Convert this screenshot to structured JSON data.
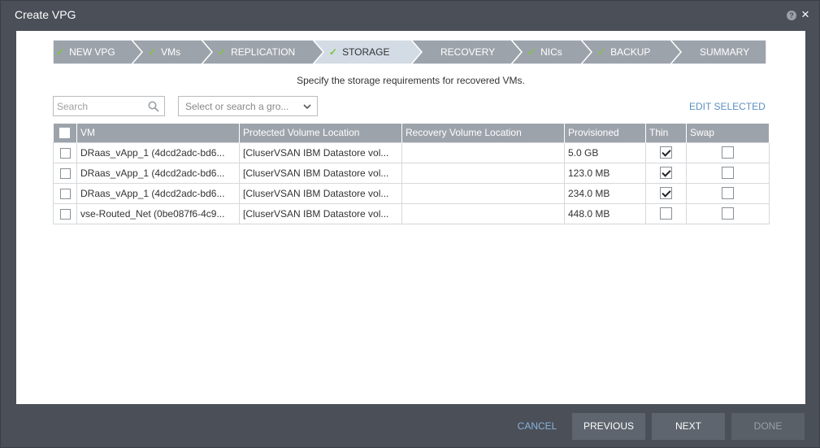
{
  "window": {
    "title": "Create VPG",
    "help_label": "?",
    "close_label": "×"
  },
  "steps": [
    {
      "label": "NEW VPG",
      "done": true
    },
    {
      "label": "VMs",
      "done": true
    },
    {
      "label": "REPLICATION",
      "done": true
    },
    {
      "label": "STORAGE",
      "done": true,
      "active": true
    },
    {
      "label": "RECOVERY",
      "done": false
    },
    {
      "label": "NICs",
      "done": true
    },
    {
      "label": "BACKUP",
      "done": true
    },
    {
      "label": "SUMMARY",
      "done": false
    }
  ],
  "check_glyph": "✓",
  "subtitle": "Specify the storage requirements for recovered VMs.",
  "search": {
    "placeholder": "Search"
  },
  "select": {
    "placeholder": "Select or search a gro..."
  },
  "edit_selected": "EDIT SELECTED",
  "table": {
    "columns": [
      "VM",
      "Protected Volume Location",
      "Recovery Volume Location",
      "Provisioned",
      "Thin",
      "Swap"
    ],
    "rows": [
      {
        "vm": "DRaas_vApp_1 (4dcd2adc-bd6...",
        "protected": "[CluserVSAN IBM Datastore vol...",
        "recovery": "",
        "provisioned": "5.0 GB",
        "thin": true,
        "swap": false
      },
      {
        "vm": "DRaas_vApp_1 (4dcd2adc-bd6...",
        "protected": "[CluserVSAN IBM Datastore vol...",
        "recovery": "",
        "provisioned": "123.0 MB",
        "thin": true,
        "swap": false
      },
      {
        "vm": "DRaas_vApp_1 (4dcd2adc-bd6...",
        "protected": "[CluserVSAN IBM Datastore vol...",
        "recovery": "",
        "provisioned": "234.0 MB",
        "thin": true,
        "swap": false
      },
      {
        "vm": "vse-Routed_Net (0be087f6-4c9...",
        "protected": "[CluserVSAN IBM Datastore vol...",
        "recovery": "",
        "provisioned": "448.0 MB",
        "thin": false,
        "swap": false
      }
    ]
  },
  "footer": {
    "cancel": "CANCEL",
    "previous": "PREVIOUS",
    "next": "NEXT",
    "done": "DONE"
  },
  "colors": {
    "step_bg": "#9da3ab",
    "step_active_bg": "#d3dce4",
    "check": "#7fc241",
    "link": "#5b8fbf",
    "dialog_bg": "#4a4f58"
  }
}
